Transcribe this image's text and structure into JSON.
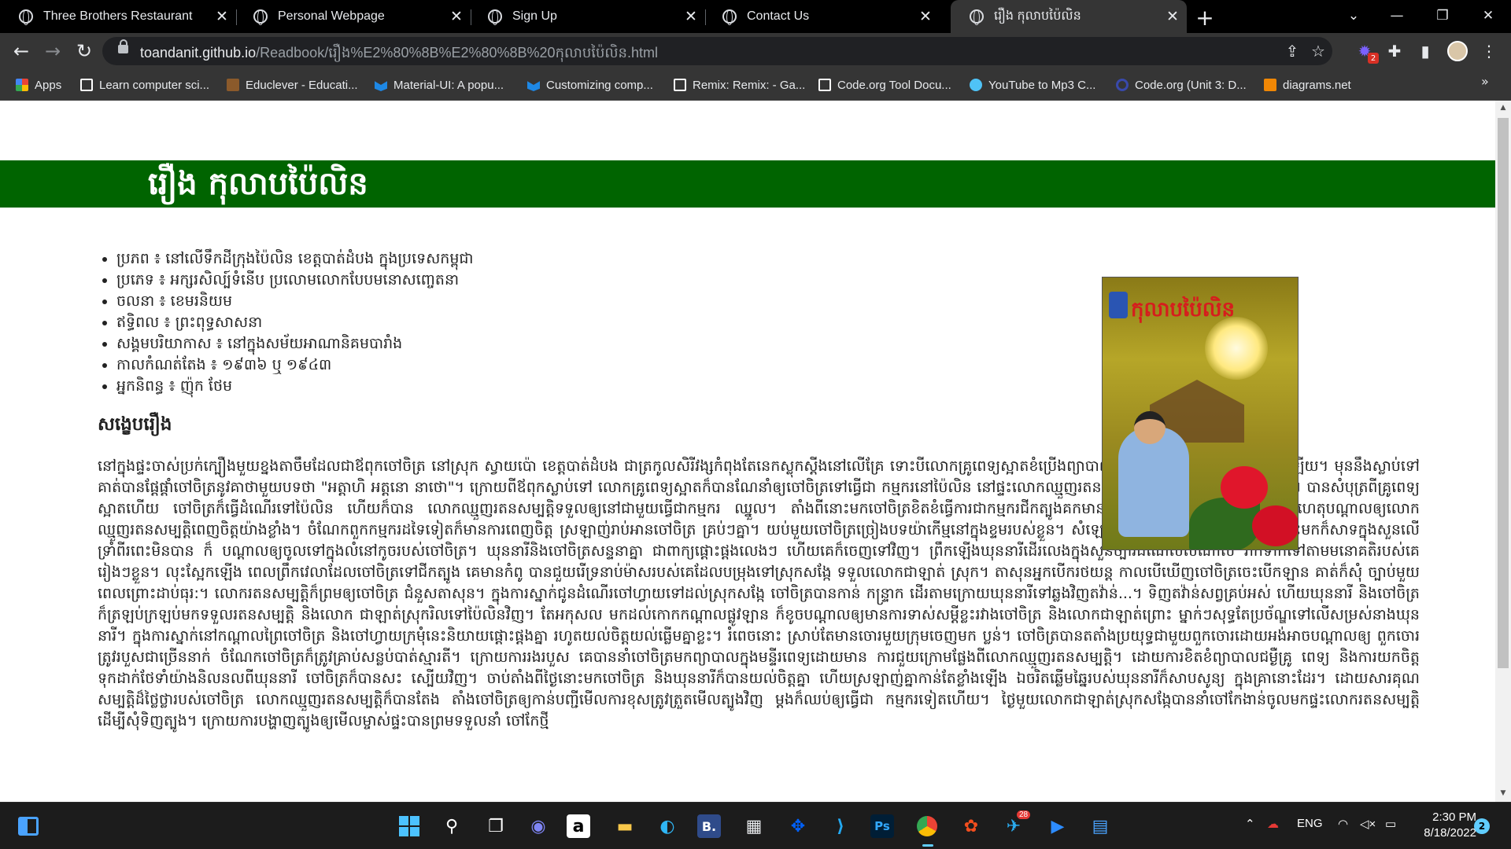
{
  "browser": {
    "tabs": [
      {
        "title": "Three Brothers Restaurant",
        "active": false
      },
      {
        "title": "Personal Webpage",
        "active": false
      },
      {
        "title": "Sign Up",
        "active": false
      },
      {
        "title": "Contact Us",
        "active": false
      },
      {
        "title": "រឿង កុលាបប៉ៃលិន",
        "active": true
      }
    ],
    "close_glyph": "✕",
    "newtab_glyph": "+",
    "url_host": "toandanit.github.io",
    "url_path": "/Readbook/រឿង%E2%80%8B%E2%80%8B%20កុលាបប៉ៃលិន.html",
    "extension_badge": "2",
    "bookmarks": [
      {
        "label": "Apps",
        "icon": "apps-grid-icon",
        "color": "#ea4335"
      },
      {
        "label": "Learn computer sci...",
        "icon": "code-org-icon",
        "color": "#ffffff"
      },
      {
        "label": "Educlever - Educati...",
        "icon": "educlever-icon",
        "color": "#8b5a2b"
      },
      {
        "label": "Material-UI: A popu...",
        "icon": "material-ui-icon",
        "color": "#1e88e5"
      },
      {
        "label": "Customizing comp...",
        "icon": "material-ui-icon",
        "color": "#1e88e5"
      },
      {
        "label": "Remix: Remix: - Ga...",
        "icon": "code-org-icon",
        "color": "#ffffff"
      },
      {
        "label": "Code.org Tool Docu...",
        "icon": "code-org-icon",
        "color": "#ffffff"
      },
      {
        "label": "YouTube to Mp3 C...",
        "icon": "download-icon",
        "color": "#4fc3f7"
      },
      {
        "label": "Code.org (Unit 3: D...",
        "icon": "search-q-icon",
        "color": "#3949ab"
      },
      {
        "label": "diagrams.net",
        "icon": "diagrams-icon",
        "color": "#f08705"
      }
    ],
    "bookmarks_more": "»"
  },
  "page": {
    "title": "រឿង កុលាបប៉ៃលិន",
    "info_items": [
      "ប្រភព ៖ នៅលើទឹកដីក្រុងប៉ៃលិន ខេត្តបាត់ដំបង ក្នុងប្រទេសកម្ពុជា",
      "ប្រភេទ ៖ អក្សរសិល្ប៍ទំនើប ប្រលោមលោកបែបមនោសញ្ចេតនា",
      "ចលនា ៖ ខេមរនិយម",
      "ឥទ្ធិពល ៖ ព្រះពុទ្ធសាសនា",
      "សង្គមបរិយាកាស ៖ នៅក្នុងសម័យអាណានិគមបារាំង",
      "កាលកំណត់តែង ៖ ១៩៣៦ ឬ ១៩៤៣",
      "អ្នកនិពន្ធ ៖ ញ៉ុក ថែម"
    ],
    "summary_heading": "សង្ខេបរឿង",
    "summary_text": "នៅក្នុងផ្ទះចាស់ប្រក់ក្បឿងមួយខ្នងតាចឹមដែលជាឪពុកចៅចិត្រ នៅស្រុក ស្វាយប៉ោ ខេត្តបាត់ដំបង ជាត្រកូលសិរីវង្សកំពុងតែនេកស្លុកស្ដីងនៅលើគ្រែ ទោះបីលោកគ្រូពេទ្យស្អាតខំប្រើងព្យាបាលយ៉ាងណាក៏ពុំអាចជាសះស្បើយ ឡើយ។ មុននឹងស្លាប់ទៅគាត់បានផ្ដែផ្ដាំចៅចិត្រនូវគាថាមួយបទថា \"អត្តាហិ អត្តនោ នាថោ\"។ ក្រោយពីឪពុកស្លាប់ទៅ លោកគ្រូពេទ្យស្អាតក៏បានណែនាំឲ្យចៅចិត្រទៅធ្វើជា កម្មករនៅប៉ៃលិន នៅផ្ទះលោកឈ្មួញរតនសម្បត្តិ ដែលជាឪពុកមារបស់លោក។ បានសំបុត្រពីគ្រូពេទ្យស្អាតហើយ ចៅចិត្រក៏ធ្វើដំណើរទៅប៉ៃលិន ហើយក៏បាន លោកឈ្មួញរតនសម្បត្តិទទួលឲ្យនៅជាមួយធ្វើជាកម្មករ ឈ្នួល។ តាំងពីនោះមកចៅចិត្រខិតខំធ្វើការជាកម្មករជីកត្បូងគកមានខ្ជិលច្រអូស ឬ ទម្រន់ឡើយ ជាហេតុបណ្ដាលឲ្យលោកឈ្មួញរតនសម្បត្តិពេញចិត្តយ៉ាងខ្លាំង។ ចំណែកពួកកម្មករដទៃទៀតក៏មានការពេញចិត្ត ស្រឡាញ់រាប់អានចៅចិត្រ គ្រប់ៗគ្នា។ យប់មួយចៅចិត្រច្រៀងបទយ៉ាកើម្មនៅក្នុងខ្ទមរបស់ខ្លួន។ សំឡេង ចម្រៀងធ្វើឲ្យឃុននារីដែលបានចុះមកក៏សាទក្នុងសួនលើទ្រាំពីរពេះមិនបាន ក៏ បណ្ដាលឲ្យចូលទៅក្នុងលំនៅកូចរបស់ចៅចិត្រ។ ឃុននារីនិងចៅចិត្រសន្ទនាគ្នា ជាពាក្យផ្ដោះផ្ដងលេងៗ ហើយគេក៏ចេញទៅវិញ។ ព្រឹកឡើងឃុននារីដើរលេងក្នុងសួនច្បារដំណែលសំណាល រាក់ទាក់ទៅតាមមនោគតិរបស់គេរៀងៗខ្លួន។ លុះស្អែកឡើង ពេលព្រឹកវេលាដែលចៅចិត្រទៅជីកត្បូង គេមានកំពូ បានជួយរើទ្រនាប់ម៉ាសរបស់គេដែលបម្រុងទៅស្រុកសង្កែ ទទួលលោកជាឡាត់ ស្រុក។ តាសុនអ្នកបើករថយន្ត កាលបើឃើញចៅចិត្រចេះបើកឡាន គាត់ក៏សុំ ច្បាប់មួយពេលព្រោះដាប់ធុរ:។ លោករតនសម្បត្តិក៏ព្រមឲ្យចៅចិត្រ ជំនួសតាសុន។ ក្នុងការស្នាក់ជូនដំណើរចៅហ្វាយទៅដល់ស្រុកសង្កែ ចៅចិត្របានកាន់ កន្ទ្រាក ដើរតាមក្រោយឃុននារីទៅឆ្លងវិញតវ៉ាន់...។ ទិញតវ៉ាន់សព្វគ្រប់អស់ ហើយឃុននារី និងចៅចិត្រក៏ត្រឡប់ក្រឡប់មកទទួលរតនសម្បត្តិ និងលោក ជាឡាត់ស្រុករិលទៅប៉ៃលិនវិញ។ តែអកុសល មកដល់កោកកណ្ដាលផ្លូវឡាន ក៏ខូចបណ្ដាលឲ្យមានការទាស់សម្ដីខ្លះរវាងចៅចិត្រ និងលោកជាឡាត់ព្រោះ ម្នាក់ៗសុទ្ធតែប្រច័ណ្ឌទៅលើសម្រស់នាងឃុននារី។ ក្នុងការស្នាក់នៅកណ្ដាលព្រៃចៅចិត្រ និងចៅហ្វាយក្រមុំនេះនិយាយផ្ដោះផ្ដងគ្នា រហូតយល់ចិត្តយល់ធ្លើមគ្នាខ្លះ។ រំពេចនោះ ស្រាប់តែមានចោរមួយក្រុមចេញមក ប្លន់។ ចៅចិត្របានតតាំងប្រយុទ្ធជាមួយពួកចោរដោយអង់អាចបណ្ដាលឲ្យ ពួកចោរត្រូវរបួសជាច្រើននាក់ ចំណែកចៅចិត្រក៏ត្រូវគ្រាប់សន្លប់បាត់ស្មារតី។ ក្រោយការរងរបួស គេបាននាំចៅចិត្រមកព្យាបាលក្នុងមន្ទីរពេទ្យដោយមាន ការជួយក្រោមផ្លែងពីលោកឈ្មួញរតនសម្បត្តិ។ ដោយការខិតខំព្យាបាលជម្ងឺគ្រូ ពេទ្យ និងការយកចិត្តទុកដាក់ថែទាំយ៉ាងនិលនលពីឃុននារី ចៅចិត្រក៏បានសះ ស្បើយវិញ។ ចាប់តាំងពីថ្ងៃនោះមកចៅចិត្រ និងឃុននារីក៏បានយល់ចិត្តគ្នា ហើយស្រឡាញ់គ្នាកាន់តែខ្លាំងឡើង ឯចរិតឆ្លើមឆ្នៃរបស់ឃុននារីក៏សាបសូន្យ ក្នុងគ្រានោះដែរ។ ដោយសារគុណសម្បត្តិដ៏ថ្លៃថ្លារបស់ចៅចិត្រ លោកឈ្មួញរតនសម្បត្តិក៏បានតែង តាំងចៅចិត្រឲ្យកាន់បញ្ជីមើលការខុសត្រូវត្រួតមើលត្បូងវិញ ម្ដងក៏ឈប់ឲ្យធ្វើជា កម្មករទៀតហើយ។ ថ្ងៃមួយលោកជាឡាត់ស្រុកសង្កែបាននាំចៅកែងាន់ចូលមកផ្ទះលោករតនសម្បត្តិ ដើម្បីសុំទិញត្បូង។ ក្រោយការបង្ហាញត្បូងឲ្យមើលម្ចាស់ផ្ទះបានព្រមទទួលនាំ ចៅកែថ្មី",
    "cover_title": "កុលាបប៉ៃលិន"
  },
  "taskbar": {
    "language": "ENG",
    "time": "2:30 PM",
    "date": "8/18/2022",
    "notifications": "2",
    "telegram_badge": "28",
    "bold_b_label": "B.",
    "ps_label": "Ps"
  }
}
